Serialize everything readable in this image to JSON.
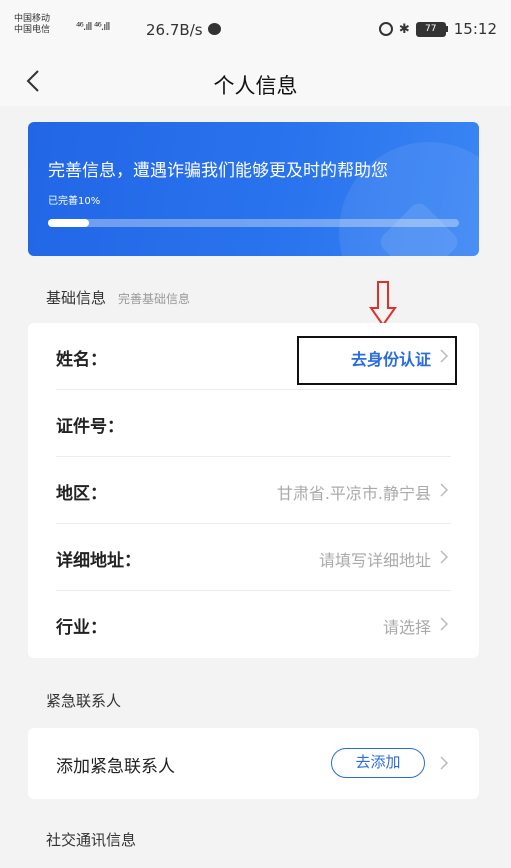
{
  "status_bar": {
    "carrier1": "中国移动",
    "carrier2": "中国电信",
    "signal": "⁴⁶.ıll ⁴⁶.ıll",
    "speed": "26.7B/s",
    "battery": "77",
    "time": "15:12"
  },
  "nav": {
    "title": "个人信息"
  },
  "banner": {
    "title": "完善信息，遭遇诈骗我们能够更及时的帮助您",
    "progress_label": "已完善10%",
    "progress": 0.1
  },
  "basic_section": {
    "title": "基础信息",
    "subtitle": "完善基础信息"
  },
  "basic_rows": [
    {
      "label": "姓名：",
      "value": "去身份认证"
    },
    {
      "label": "证件号：",
      "value": ""
    },
    {
      "label": "地区：",
      "value": "甘肃省.平凉市.静宁县"
    },
    {
      "label": "详细地址：",
      "value": "请填写详细地址"
    },
    {
      "label": "行业：",
      "value": "请选择"
    }
  ],
  "emergency_section": {
    "title": "紧急联系人"
  },
  "emergency_row": {
    "label": "添加紧急联系人",
    "button": "去添加"
  },
  "social_section": {
    "title": "社交通讯信息"
  },
  "colors": {
    "accent": "#2a6cdf",
    "banner": "#2266e6",
    "annotation": "#e0302a"
  }
}
